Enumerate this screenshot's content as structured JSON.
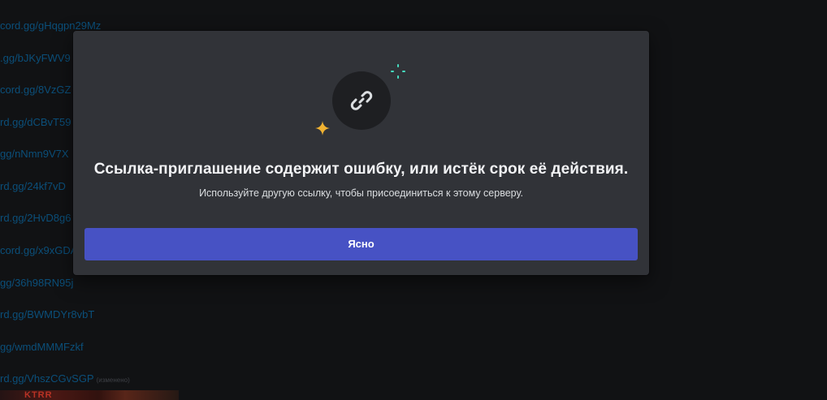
{
  "background": {
    "links": [
      "cord.gg/gHqgpn29Mz",
      ".gg/bJKyFWV9",
      "cord.gg/8VzGZ",
      "rd.gg/dCBvT59",
      "gg/nNmn9V7X",
      "rd.gg/24kf7vD",
      "rd.gg/2HvD8g6",
      "cord.gg/x9xGDA",
      "gg/36h98RN95j",
      "rd.gg/BWMDYr8vbT",
      "gg/wmdMMMFzkf",
      "rd.gg/VhszCGvSGP"
    ],
    "edited_label": "(изменено)",
    "thumbnail_text": "KTRR"
  },
  "modal": {
    "title": "Ссылка-приглашение содержит ошибку, или истёк срок её действия.",
    "subtitle": "Используйте другую ссылку, чтобы присоединиться к этому серверу.",
    "button_label": "Ясно",
    "icon": "link-icon",
    "colors": {
      "accent": "#4752c4",
      "sparkle_yellow": "#f0b232",
      "sparkle_cyan": "#45ddc0",
      "modal_bg": "#313338",
      "icon_bg": "#1e1f22"
    }
  }
}
